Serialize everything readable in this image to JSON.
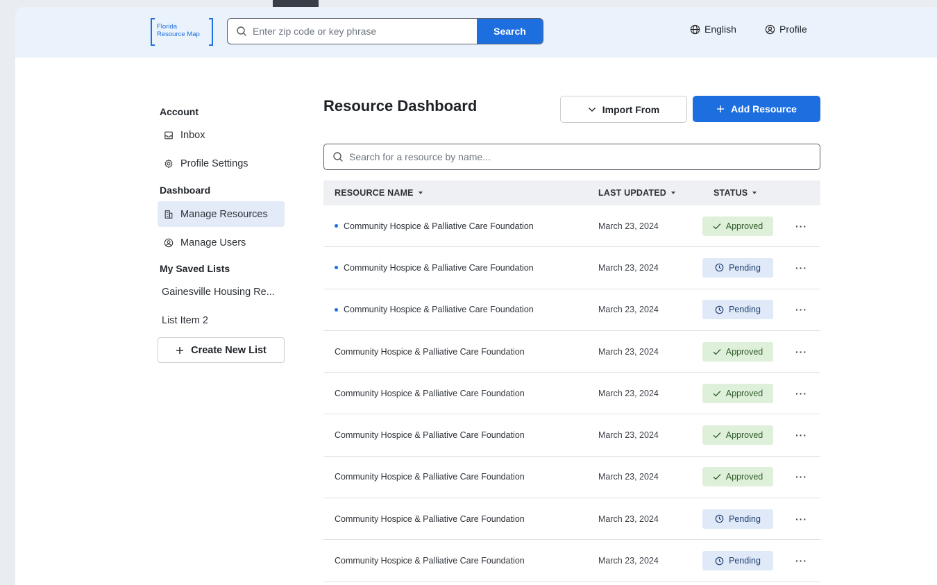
{
  "header": {
    "logo_line1": "Florida",
    "logo_line2": "Resource Map",
    "search_placeholder": "Enter zip code or key phrase",
    "search_button": "Search",
    "language": "English",
    "profile": "Profile"
  },
  "sidebar": {
    "account_heading": "Account",
    "inbox": "Inbox",
    "profile_settings": "Profile Settings",
    "dashboard_heading": "Dashboard",
    "manage_resources": "Manage Resources",
    "manage_users": "Manage Users",
    "saved_lists_heading": "My Saved Lists",
    "saved_list_1": "Gainesville Housing Re...",
    "saved_list_2": "List Item 2",
    "create_new_list": "Create New List"
  },
  "main": {
    "title": "Resource Dashboard",
    "import_button": "Import From",
    "add_button": "Add Resource",
    "search_placeholder": "Search for a resource by name...",
    "columns": {
      "name": "RESOURCE NAME",
      "updated": "LAST UPDATED",
      "status": "STATUS"
    },
    "rows": [
      {
        "name": "Community Hospice & Palliative Care Foundation",
        "updated": "March 23, 2024",
        "status": "Approved",
        "unread": true
      },
      {
        "name": "Community Hospice & Palliative Care Foundation",
        "updated": "March 23, 2024",
        "status": "Pending",
        "unread": true
      },
      {
        "name": "Community Hospice & Palliative Care Foundation",
        "updated": "March 23, 2024",
        "status": "Pending",
        "unread": true
      },
      {
        "name": "Community Hospice & Palliative Care Foundation",
        "updated": "March 23, 2024",
        "status": "Approved",
        "unread": false
      },
      {
        "name": "Community Hospice & Palliative Care Foundation",
        "updated": "March 23, 2024",
        "status": "Approved",
        "unread": false
      },
      {
        "name": "Community Hospice & Palliative Care Foundation",
        "updated": "March 23, 2024",
        "status": "Approved",
        "unread": false
      },
      {
        "name": "Community Hospice & Palliative Care Foundation",
        "updated": "March 23, 2024",
        "status": "Approved",
        "unread": false
      },
      {
        "name": "Community Hospice & Palliative Care Foundation",
        "updated": "March 23, 2024",
        "status": "Pending",
        "unread": false
      },
      {
        "name": "Community Hospice & Palliative Care Foundation",
        "updated": "March 23, 2024",
        "status": "Pending",
        "unread": false
      }
    ],
    "more_label": "···"
  },
  "colors": {
    "accent": "#1d6fe0",
    "header_bg": "#eaf2fb",
    "approved_bg": "#dff0da",
    "pending_bg": "#dfe9f8"
  }
}
